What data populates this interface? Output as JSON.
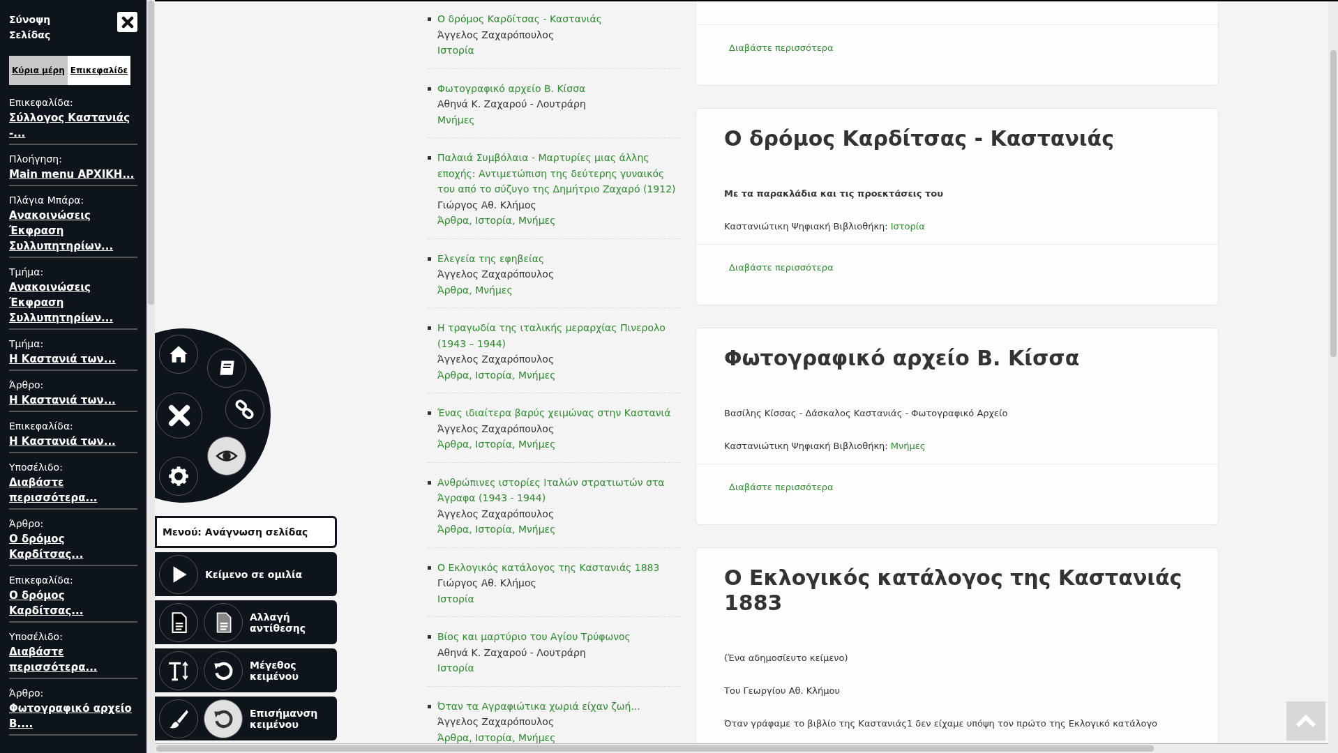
{
  "sidebar": {
    "title": "Σύνοψη Σελίδας",
    "tabs": [
      {
        "label": "Κύρια μέρη",
        "selected": true
      },
      {
        "label": "Επικεφαλίδε",
        "selected": false
      }
    ],
    "items": [
      {
        "label": "Επικεφαλίδα:",
        "link": "Σύλλογος Καστανιάς -..."
      },
      {
        "label": "Πλοήγηση:",
        "link": "Main menu ΑΡΧΙΚΗ..."
      },
      {
        "label": "Πλάγια Μπάρα:",
        "link": "Ανακοινώσεις Έκφραση Συλλυπητηρίων..."
      },
      {
        "label": "Τμήμα:",
        "link": "Ανακοινώσεις Έκφραση Συλλυπητηρίων..."
      },
      {
        "label": "Τμήμα:",
        "link": "Η Καστανιά των..."
      },
      {
        "label": "Άρθρο:",
        "link": "Η Καστανιά των..."
      },
      {
        "label": "Επικεφαλίδα:",
        "link": "Η Καστανιά των..."
      },
      {
        "label": "Υποσέλιδο:",
        "link": "Διαβάστε περισσότερα..."
      },
      {
        "label": "Άρθρο:",
        "link": "Ο δρόμος Καρδίτσας..."
      },
      {
        "label": "Επικεφαλίδα:",
        "link": "Ο δρόμος Καρδίτσας..."
      },
      {
        "label": "Υποσέλιδο:",
        "link": "Διαβάστε περισσότερα..."
      },
      {
        "label": "Άρθρο:",
        "link": "Φωτογραφικό αρχείο Β...."
      }
    ]
  },
  "reading_menu": {
    "label": "Μενού: Ανάγνωση σελίδας",
    "radial_buttons": [
      {
        "kind": "home",
        "selected": false
      },
      {
        "kind": "book",
        "selected": false
      },
      {
        "kind": "close",
        "selected": false
      },
      {
        "kind": "link",
        "selected": false
      },
      {
        "kind": "eye",
        "selected": true
      },
      {
        "kind": "gear",
        "selected": false
      }
    ],
    "buttons": [
      {
        "label": "Κείμενο σε ομιλία",
        "icons": [
          {
            "kind": "play",
            "selected": false
          }
        ]
      },
      {
        "label": "Αλλαγή αντίθεσης",
        "icons": [
          {
            "kind": "doc-dark",
            "selected": false
          },
          {
            "kind": "doc-gray",
            "selected": false
          }
        ]
      },
      {
        "label": "Μέγεθος κειμένου",
        "icons": [
          {
            "kind": "text-size",
            "selected": false
          },
          {
            "kind": "reset",
            "selected": false
          }
        ]
      },
      {
        "label": "Επισήμανση κειμένου",
        "icons": [
          {
            "kind": "brush",
            "selected": false
          },
          {
            "kind": "reset",
            "selected": true
          }
        ]
      }
    ]
  },
  "article_list": [
    {
      "title": "Ο δρόμος Καρδίτσας - Καστανιάς",
      "author": "Άγγελος Ζαχαρόπουλος",
      "categories": "Ιστορία"
    },
    {
      "title": "Φωτογραφικό αρχείο Β. Κίσσα",
      "author": "Αθηνά Κ. Ζαχαρού - Λουτράρη",
      "categories": "Μνήμες"
    },
    {
      "title": "Παλαιά Συμβόλαια - Μαρτυρίες μιας άλλης εποχής: Αντιμετώπιση της δεύτερης γυναικός του από το σύζυγο της Δημήτριο Ζαχαρό (1912)",
      "author": "Γιώργος Αθ. Κλήμος",
      "categories": "Άρθρα, Ιστορία, Μνήμες"
    },
    {
      "title": "Ελεγεία της εφηβείας",
      "author": "Άγγελος Ζαχαρόπουλος",
      "categories": "Άρθρα, Μνήμες"
    },
    {
      "title": "Η τραγωδία της ιταλικής μεραρχίας Πινερολο (1943 – 1944)",
      "author": "Άγγελος Ζαχαρόπουλος",
      "categories": "Άρθρα, Ιστορία, Μνήμες"
    },
    {
      "title": "Ένας ιδιαίτερα βαρύς χειμώνας στην Καστανιά",
      "author": "Άγγελος Ζαχαρόπουλος",
      "categories": "Άρθρα, Ιστορία, Μνήμες"
    },
    {
      "title": "Ανθρώπινες ιστορίες Ιταλών στρατιωτών στα Άγραφα (1943 - 1944)",
      "author": "Άγγελος Ζαχαρόπουλος",
      "categories": "Άρθρα, Ιστορία, Μνήμες"
    },
    {
      "title": "Ο Εκλογικός κατάλογος της Καστανιάς 1883",
      "author": "Γιώργος Αθ. Κλήμος",
      "categories": "Ιστορία"
    },
    {
      "title": "Βίος και μαρτύριο του Αγίου Τρύφωνος",
      "author": "Αθηνά Κ. Ζαχαρού - Λουτράρη",
      "categories": "Ιστορία"
    },
    {
      "title": "Όταν τα Αγραφιώτικα χωριά είχαν ζωή...",
      "author": "Άγγελος Ζαχαρόπουλος",
      "categories": "Άρθρα, Ιστορία, Μνήμες"
    }
  ],
  "cards": [
    {
      "read_more": "Διαβάστε περισσότερα"
    },
    {
      "title": "Ο δρόμος Καρδίτσας - Καστανιάς",
      "paragraphs": [
        {
          "text": "Με τα παρακλάδια και τις προεκτάσεις του",
          "bold": true
        }
      ],
      "meta": {
        "label": "Καστανιώτικη Ψηφιακή Βιβλιοθήκη:",
        "category": "Ιστορία"
      },
      "read_more": "Διαβάστε περισσότερα"
    },
    {
      "title": "Φωτογραφικό αρχείο Β. Κίσσα",
      "paragraphs": [
        {
          "text": "Βασίλης Κίσσας - Δάσκαλος Καστανιάς - Φωτογραφικό Αρχείο",
          "bold": false
        }
      ],
      "meta": {
        "label": "Καστανιώτικη Ψηφιακή Βιβλιοθήκη:",
        "category": "Μνήμες"
      },
      "read_more": "Διαβάστε περισσότερα"
    },
    {
      "title": "Ο Εκλογικός κατάλογος της Καστανιάς 1883",
      "paragraphs": [
        {
          "text": "(Ένα αδημοσίευτο κείμενο)",
          "bold": false
        },
        {
          "text": "Του Γεωργίου Αθ. Κλήμου",
          "bold": false
        },
        {
          "text": "Όταν γράφαμε το βιβλίο της Καστανιάς1 δεν είχαμε υπόψη τον πρώτο της Εκλογικό κατάλογο",
          "bold": false
        }
      ]
    }
  ]
}
